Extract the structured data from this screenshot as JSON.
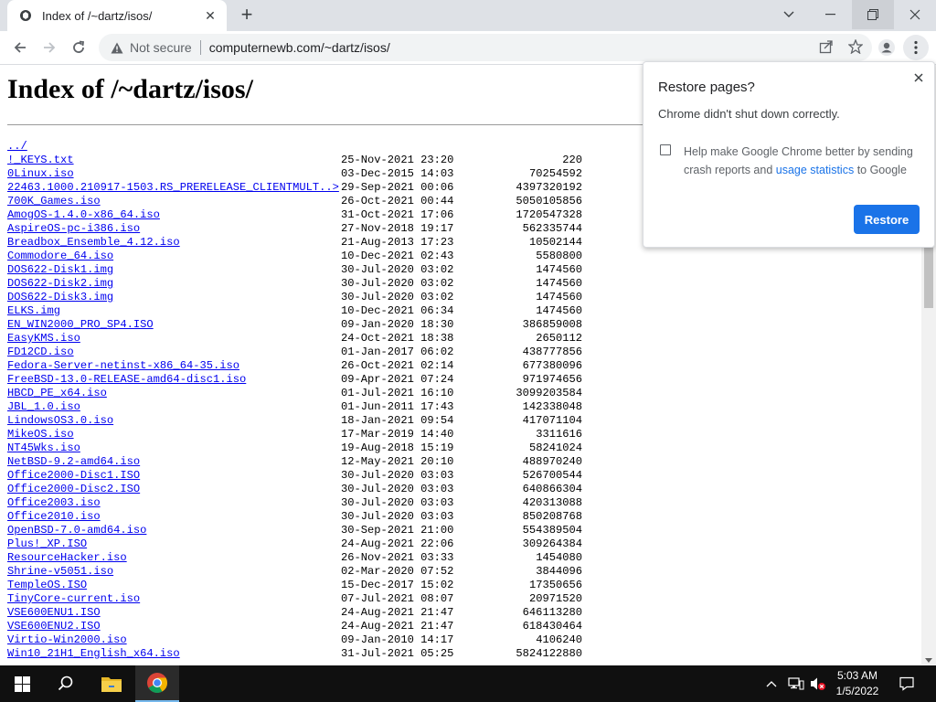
{
  "browser": {
    "tab_title": "Index of /~dartz/isos/",
    "close_tab_symbol": "✕",
    "new_tab_symbol": "+",
    "security_label": "Not secure",
    "url": "computernewb.com/~dartz/isos/"
  },
  "page": {
    "heading": "Index of /~dartz/isos/",
    "parent_link": "../",
    "entries": [
      {
        "name": "!_KEYS.txt",
        "date": "25-Nov-2021 23:20",
        "size": "220"
      },
      {
        "name": "0Linux.iso",
        "date": "03-Dec-2015 14:03",
        "size": "70254592"
      },
      {
        "name": "22463.1000.210917-1503.RS_PRERELEASE_CLIENTMULT..>",
        "date": "29-Sep-2021 00:06",
        "size": "4397320192"
      },
      {
        "name": "700K_Games.iso",
        "date": "26-Oct-2021 00:44",
        "size": "5050105856"
      },
      {
        "name": "AmogOS-1.4.0-x86_64.iso",
        "date": "31-Oct-2021 17:06",
        "size": "1720547328"
      },
      {
        "name": "AspireOS-pc-i386.iso",
        "date": "27-Nov-2018 19:17",
        "size": "562335744"
      },
      {
        "name": "Breadbox_Ensemble_4.12.iso",
        "date": "21-Aug-2013 17:23",
        "size": "10502144"
      },
      {
        "name": "Commodore_64.iso",
        "date": "10-Dec-2021 02:43",
        "size": "5580800"
      },
      {
        "name": "DOS622-Disk1.img",
        "date": "30-Jul-2020 03:02",
        "size": "1474560"
      },
      {
        "name": "DOS622-Disk2.img",
        "date": "30-Jul-2020 03:02",
        "size": "1474560"
      },
      {
        "name": "DOS622-Disk3.img",
        "date": "30-Jul-2020 03:02",
        "size": "1474560"
      },
      {
        "name": "ELKS.img",
        "date": "10-Dec-2021 06:34",
        "size": "1474560"
      },
      {
        "name": "EN_WIN2000_PRO_SP4.ISO",
        "date": "09-Jan-2020 18:30",
        "size": "386859008"
      },
      {
        "name": "EasyKMS.iso",
        "date": "24-Oct-2021 18:38",
        "size": "2650112"
      },
      {
        "name": "FD12CD.iso",
        "date": "01-Jan-2017 06:02",
        "size": "438777856"
      },
      {
        "name": "Fedora-Server-netinst-x86_64-35.iso",
        "date": "26-Oct-2021 02:14",
        "size": "677380096"
      },
      {
        "name": "FreeBSD-13.0-RELEASE-amd64-disc1.iso",
        "date": "09-Apr-2021 07:24",
        "size": "971974656"
      },
      {
        "name": "HBCD_PE_x64.iso",
        "date": "01-Jul-2021 16:10",
        "size": "3099203584"
      },
      {
        "name": "JBL_1.0.iso",
        "date": "01-Jun-2011 17:43",
        "size": "142338048"
      },
      {
        "name": "LindowsOS3.0.iso",
        "date": "18-Jan-2021 09:54",
        "size": "417071104"
      },
      {
        "name": "MikeOS.iso",
        "date": "17-Mar-2019 14:40",
        "size": "3311616"
      },
      {
        "name": "NT45Wks.iso",
        "date": "19-Aug-2018 15:19",
        "size": "58241024"
      },
      {
        "name": "NetBSD-9.2-amd64.iso",
        "date": "12-May-2021 20:10",
        "size": "488970240"
      },
      {
        "name": "Office2000-Disc1.ISO",
        "date": "30-Jul-2020 03:03",
        "size": "526700544"
      },
      {
        "name": "Office2000-Disc2.ISO",
        "date": "30-Jul-2020 03:03",
        "size": "640866304"
      },
      {
        "name": "Office2003.iso",
        "date": "30-Jul-2020 03:03",
        "size": "420313088"
      },
      {
        "name": "Office2010.iso",
        "date": "30-Jul-2020 03:03",
        "size": "850208768"
      },
      {
        "name": "OpenBSD-7.0-amd64.iso",
        "date": "30-Sep-2021 21:00",
        "size": "554389504"
      },
      {
        "name": "Plus!_XP.ISO",
        "date": "24-Aug-2021 22:06",
        "size": "309264384"
      },
      {
        "name": "ResourceHacker.iso",
        "date": "26-Nov-2021 03:33",
        "size": "1454080"
      },
      {
        "name": "Shrine-v5051.iso",
        "date": "02-Mar-2020 07:52",
        "size": "3844096"
      },
      {
        "name": "TempleOS.ISO",
        "date": "15-Dec-2017 15:02",
        "size": "17350656"
      },
      {
        "name": "TinyCore-current.iso",
        "date": "07-Jul-2021 08:07",
        "size": "20971520"
      },
      {
        "name": "VSE600ENU1.ISO",
        "date": "24-Aug-2021 21:47",
        "size": "646113280"
      },
      {
        "name": "VSE600ENU2.ISO",
        "date": "24-Aug-2021 21:47",
        "size": "618430464"
      },
      {
        "name": "Virtio-Win2000.iso",
        "date": "09-Jan-2010 14:17",
        "size": "4106240"
      },
      {
        "name": "Win10_21H1_English_x64.iso",
        "date": "31-Jul-2021 05:25",
        "size": "5824122880"
      }
    ]
  },
  "restore_popup": {
    "title": "Restore pages?",
    "message": "Chrome didn't shut down correctly.",
    "checkbox_text_before": "Help make Google Chrome better by sending crash reports and ",
    "checkbox_link": "usage statistics",
    "checkbox_text_after": " to Google",
    "restore_button": "Restore"
  },
  "taskbar": {
    "time": "5:03 AM",
    "date": "1/5/2022"
  },
  "colors": {
    "accent": "#1a73e8",
    "link": "#0000ee",
    "taskbar": "#101010"
  }
}
